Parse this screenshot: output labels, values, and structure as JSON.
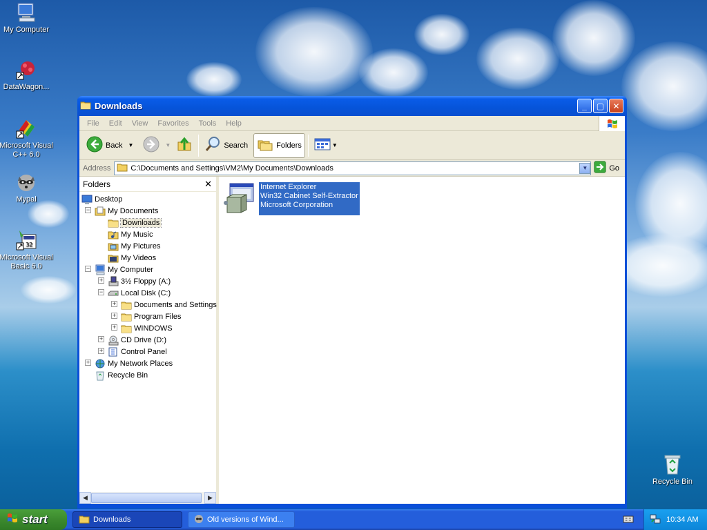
{
  "desktop": {
    "icons": [
      {
        "label": "My Computer"
      },
      {
        "label": "DataWagon..."
      },
      {
        "label": "Microsoft Visual C++ 6.0"
      },
      {
        "label": "Mypal"
      },
      {
        "label": "Microsoft Visual Basic 6.0"
      },
      {
        "label": "Recycle Bin"
      }
    ]
  },
  "window": {
    "title": "Downloads",
    "menu": [
      "File",
      "Edit",
      "View",
      "Favorites",
      "Tools",
      "Help"
    ],
    "toolbar": {
      "back": "Back",
      "search": "Search",
      "folders": "Folders"
    },
    "address": {
      "label": "Address",
      "value": "C:\\Documents and Settings\\VM2\\My Documents\\Downloads",
      "go": "Go"
    },
    "folders_pane": {
      "title": "Folders",
      "tree": [
        "Desktop",
        "My Documents",
        "Downloads",
        "My Music",
        "My Pictures",
        "My Videos",
        "My Computer",
        "3½ Floppy (A:)",
        "Local Disk (C:)",
        "Documents and Settings",
        "Program Files",
        "WINDOWS",
        "CD Drive (D:)",
        "Control Panel",
        "My Network Places",
        "Recycle Bin"
      ]
    },
    "file": {
      "line1": "Internet Explorer",
      "line2": "Win32 Cabinet Self-Extractor",
      "line3": "Microsoft Corporation"
    }
  },
  "taskbar": {
    "start": "start",
    "tasks": [
      "Downloads",
      "Old versions of Wind..."
    ],
    "clock": "10:34 AM"
  }
}
